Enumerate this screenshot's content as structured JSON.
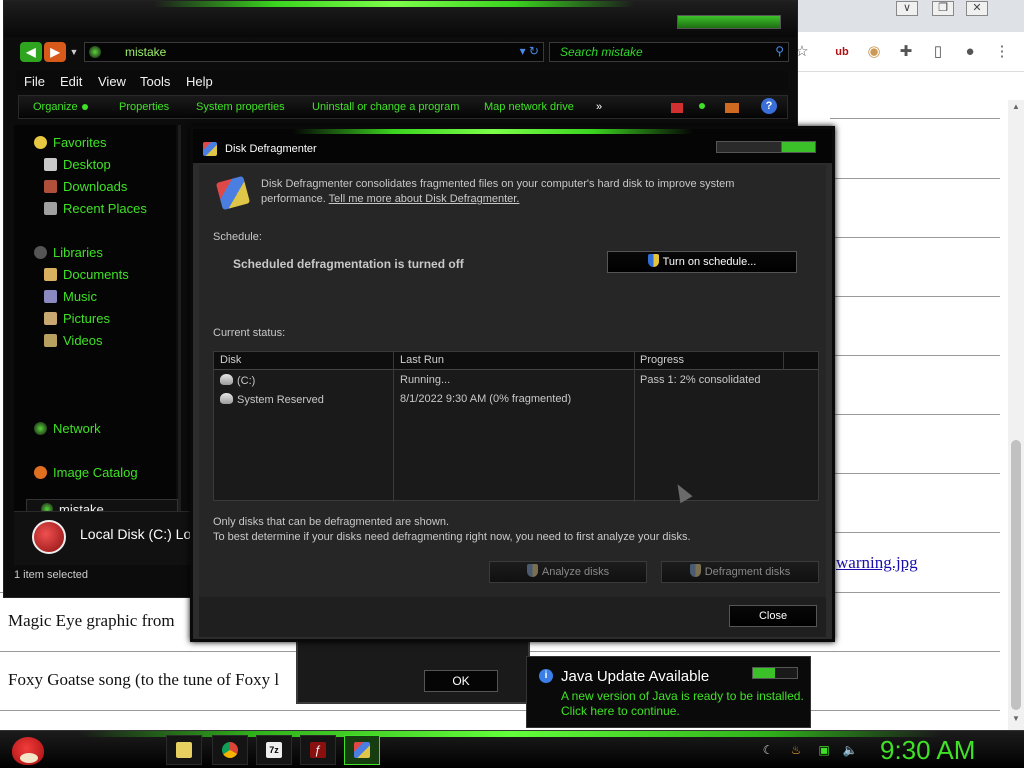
{
  "browser": {
    "caption_buttons": {
      "min": "∨",
      "restore": "❐",
      "close": "✕"
    },
    "toolbar_icons": [
      "star-icon",
      "ublock-icon",
      "extension-icon",
      "puzzle-icon",
      "sidepanel-icon",
      "profile-icon",
      "menu-icon"
    ],
    "page_lines": [
      "Magic Eye graphic from",
      "Foxy Goatse song (to the tune of Foxy l"
    ],
    "link_text": "warning.jpg"
  },
  "explorer": {
    "address_text": "mistake",
    "search_placeholder": "Search mistake",
    "menu": [
      "File",
      "Edit",
      "View",
      "Tools",
      "Help"
    ],
    "commands": [
      "Organize",
      "Properties",
      "System properties",
      "Uninstall or change a program",
      "Map network drive",
      "»"
    ],
    "nav": {
      "favorites": "Favorites",
      "desktop": "Desktop",
      "downloads": "Downloads",
      "recent": "Recent Places",
      "libraries": "Libraries",
      "documents": "Documents",
      "music": "Music",
      "pictures": "Pictures",
      "videos": "Videos",
      "mistake": "mistake",
      "network": "Network",
      "image_catalog": "Image Catalog"
    },
    "details_drive": "Local Disk (C:) Loc",
    "status": "1 item selected"
  },
  "dialog_behind": {
    "ok": "OK"
  },
  "defrag": {
    "title": "Disk Defragmenter",
    "intro": "Disk Defragmenter consolidates fragmented files on your computer's hard disk to improve system performance.",
    "intro_link": "Tell me more about Disk Defragmenter.",
    "schedule_label": "Schedule:",
    "schedule_status": "Scheduled defragmentation is turned off",
    "schedule_button": "Turn on schedule...",
    "current_status_label": "Current status:",
    "columns": [
      "Disk",
      "Last Run",
      "Progress"
    ],
    "rows": [
      {
        "disk": "(C:)",
        "last_run": "Running...",
        "progress": "Pass 1: 2% consolidated"
      },
      {
        "disk": "System Reserved",
        "last_run": "8/1/2022 9:30 AM (0% fragmented)",
        "progress": ""
      }
    ],
    "note_line1": "Only disks that can be defragmented are shown.",
    "note_line2": "To best determine if your disks need defragmenting right now, you need to first analyze your disks.",
    "analyze_button": "Analyze disks",
    "defragment_button": "Defragment disks",
    "close_button": "Close"
  },
  "java": {
    "title": "Java Update Available",
    "line1": "A new version of Java is ready to be installed.",
    "line2": "Click here to continue."
  },
  "taskbar": {
    "apps": [
      "file-explorer-icon",
      "chrome-icon",
      "7zip-icon",
      "flash-icon",
      "defrag-icon"
    ],
    "clock": "9:30 AM"
  },
  "colors": {
    "accent_green": "#3fe226",
    "window_bg": "#2c2c2c"
  }
}
